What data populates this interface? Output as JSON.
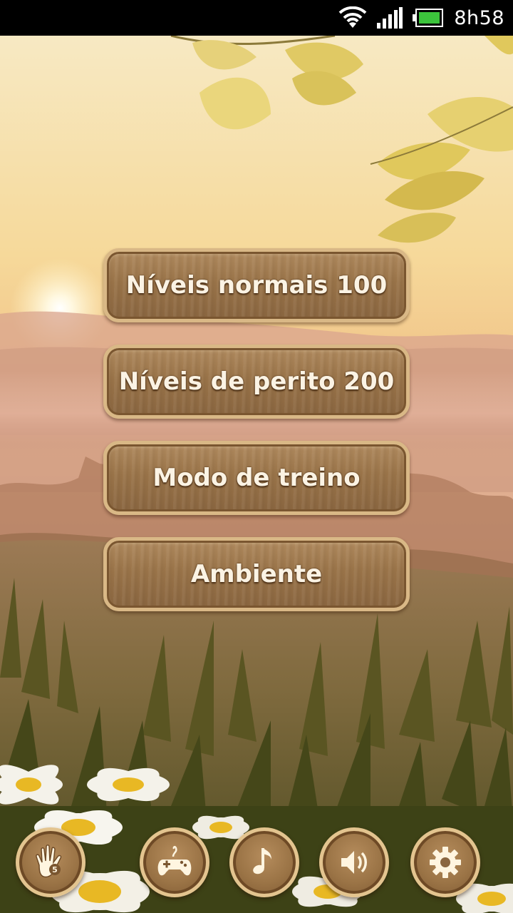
{
  "status_bar": {
    "time": "8h58",
    "icons": [
      "wifi-icon",
      "signal-icon",
      "battery-icon"
    ]
  },
  "menu": {
    "buttons": [
      {
        "label": "Níveis normais 100"
      },
      {
        "label": "Níveis de perito 200"
      },
      {
        "label": "Modo de treino"
      },
      {
        "label": "Ambiente"
      }
    ]
  },
  "bottom_bar": {
    "icons": [
      "hand-icon",
      "gamepad-icon",
      "music-note-icon",
      "speaker-icon",
      "gear-icon"
    ]
  },
  "colors": {
    "wood": "#9a7449",
    "wood_border": "#d9b886",
    "label": "#fbf3e4"
  }
}
